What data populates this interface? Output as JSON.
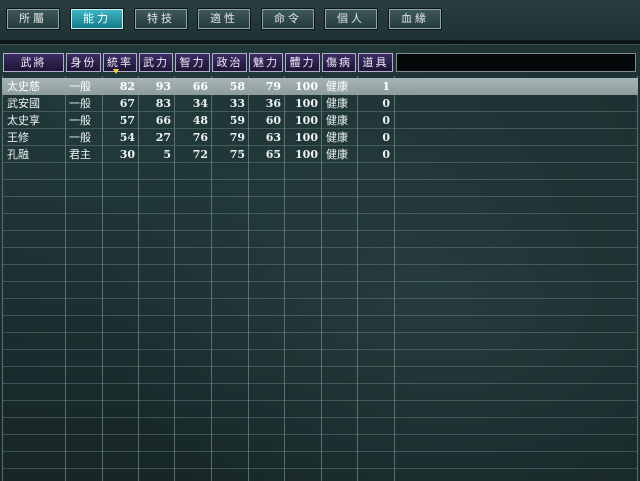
{
  "tabs": [
    {
      "label": "所屬",
      "active": false
    },
    {
      "label": "能力",
      "active": true
    },
    {
      "label": "特技",
      "active": false
    },
    {
      "label": "適性",
      "active": false
    },
    {
      "label": "命令",
      "active": false
    },
    {
      "label": "個人",
      "active": false
    },
    {
      "label": "血緣",
      "active": false
    }
  ],
  "columns": [
    "武將",
    "身份",
    "統率",
    "武力",
    "智力",
    "政治",
    "魅力",
    "體力",
    "傷病",
    "道具"
  ],
  "sorted_column": "統率",
  "rows": [
    {
      "name": "太史慈",
      "rank": "一般",
      "lead": "82",
      "war": "93",
      "int": "66",
      "pol": "58",
      "chr": "79",
      "hp": "100",
      "status": "健康",
      "items": "1",
      "selected": true
    },
    {
      "name": "武安國",
      "rank": "一般",
      "lead": "67",
      "war": "83",
      "int": "34",
      "pol": "33",
      "chr": "36",
      "hp": "100",
      "status": "健康",
      "items": "0",
      "selected": false
    },
    {
      "name": "太史享",
      "rank": "一般",
      "lead": "57",
      "war": "66",
      "int": "48",
      "pol": "59",
      "chr": "60",
      "hp": "100",
      "status": "健康",
      "items": "0",
      "selected": false
    },
    {
      "name": "王修",
      "rank": "一般",
      "lead": "54",
      "war": "27",
      "int": "76",
      "pol": "79",
      "chr": "63",
      "hp": "100",
      "status": "健康",
      "items": "0",
      "selected": false
    },
    {
      "name": "孔融",
      "rank": "君主",
      "lead": "30",
      "war": "5",
      "int": "72",
      "pol": "75",
      "chr": "65",
      "hp": "100",
      "status": "健康",
      "items": "0",
      "selected": false
    }
  ],
  "colors": {
    "active_tab": "#2a9fb0",
    "header": "#2d2250",
    "selected_row": "#9aa8a9",
    "sort_marker": "#f2d23c"
  }
}
